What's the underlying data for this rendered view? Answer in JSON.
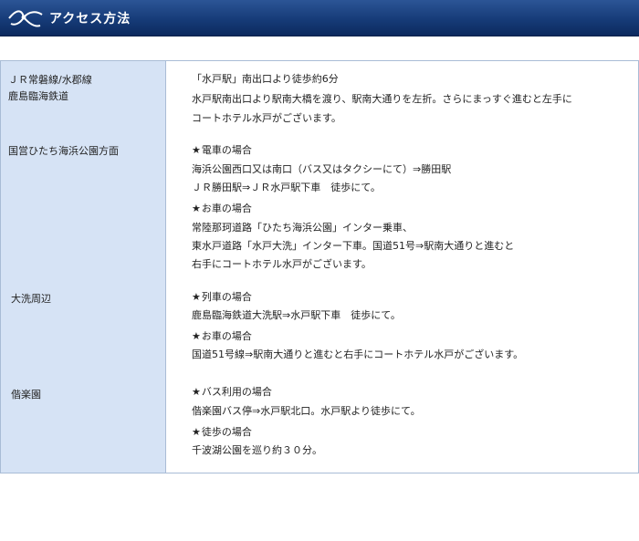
{
  "header": {
    "title": "アクセス方法",
    "icon": "ribbon-icon"
  },
  "sections": [
    {
      "labels": [
        "ＪＲ常磐線/水郡線",
        "鹿島臨海鉄道"
      ],
      "lines": [
        "「水戸駅」南出口より徒歩約6分",
        "水戸駅南出口より駅南大橋を渡り、駅南大通りを左折。さらにまっすぐ進むと左手に",
        "コートホテル水戸がございます。"
      ]
    },
    {
      "labels": [
        "国営ひたち海浜公園方面"
      ],
      "blocks": [
        {
          "heading": "電車の場合",
          "lines": [
            "海浜公園西口又は南口（バス又はタクシーにて）⇒勝田駅",
            "ＪＲ勝田駅⇒ＪＲ水戸駅下車　徒歩にて。"
          ]
        },
        {
          "heading": "お車の場合",
          "lines": [
            "常陸那珂道路「ひたち海浜公園」インター乗車、",
            "東水戸道路「水戸大洗」インター下車。国道51号⇒駅南大通りと進むと",
            "右手にコートホテル水戸がございます。"
          ]
        }
      ]
    },
    {
      "labels": [
        "大洗周辺"
      ],
      "blocks": [
        {
          "heading": "列車の場合",
          "lines": [
            "鹿島臨海鉄道大洗駅⇒水戸駅下車　徒歩にて。"
          ]
        },
        {
          "heading": "お車の場合",
          "lines": [
            "国道51号線⇒駅南大通りと進むと右手にコートホテル水戸がございます。"
          ]
        }
      ]
    },
    {
      "labels": [
        "偕楽園"
      ],
      "blocks": [
        {
          "heading": "バス利用の場合",
          "lines": [
            "偕楽園バス停⇒水戸駅北口。水戸駅より徒歩にて。"
          ]
        },
        {
          "heading": "徒歩の場合",
          "lines": [
            "千波湖公園を巡り約３０分。"
          ]
        }
      ]
    }
  ],
  "star_glyph": "★"
}
